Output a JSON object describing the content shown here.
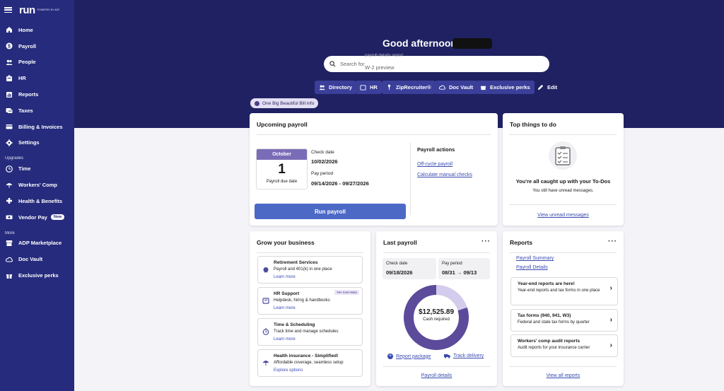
{
  "sidebar": {
    "logo": "run",
    "logo_sub": "POWERED BY ADP",
    "items": [
      {
        "label": "Home",
        "icon": "home-icon"
      },
      {
        "label": "Payroll",
        "icon": "dollar-icon"
      },
      {
        "label": "People",
        "icon": "people-icon"
      },
      {
        "label": "HR",
        "icon": "hr-icon"
      },
      {
        "label": "Reports",
        "icon": "reports-icon"
      },
      {
        "label": "Taxes",
        "icon": "taxes-icon"
      },
      {
        "label": "Billing & Invoices",
        "icon": "billing-icon"
      },
      {
        "label": "Settings",
        "icon": "gear-icon"
      }
    ],
    "upgrades_label": "Upgrades",
    "upgrades": [
      {
        "label": "Time",
        "icon": "clock-icon"
      },
      {
        "label": "Workers' Comp",
        "icon": "umbrella-icon"
      },
      {
        "label": "Health & Benefits",
        "icon": "health-icon"
      },
      {
        "label": "Vendor Pay",
        "icon": "vendor-icon",
        "badge": "New"
      }
    ],
    "more_label": "More",
    "more": [
      {
        "label": "ADP Marketplace",
        "icon": "marketplace-icon"
      },
      {
        "label": "Doc Vault",
        "icon": "cloud-icon"
      },
      {
        "label": "Exclusive perks",
        "icon": "gift-icon"
      }
    ]
  },
  "header": {
    "greeting": "Good afternoon,",
    "search_placeholder": "Search for",
    "search_ghost_1": "payroll details report",
    "search_ghost_2": "W-2 preview",
    "quick_links": [
      "Directory",
      "HR",
      "ZipRecruiter®",
      "Doc Vault",
      "Exclusive perks",
      "Edit"
    ],
    "info_pill": "One Big Beautiful Bill info"
  },
  "upcoming": {
    "title": "Upcoming payroll",
    "month": "October",
    "day": "1",
    "due_label": "Payroll due date",
    "check_date_label": "Check date",
    "check_date": "10/02/2026",
    "pay_period_label": "Pay period",
    "pay_period": "09/14/2026 - 09/27/2026",
    "actions_title": "Payroll actions",
    "off_cycle": "Off-cycle payroll",
    "calc_manual": "Calculate manual checks",
    "run_button": "Run payroll"
  },
  "todo": {
    "title": "Top things to do",
    "headline": "You're all caught up with your To-Dos",
    "sub": "You still have unread messages.",
    "link": "View unread messages"
  },
  "grow": {
    "title": "Grow your business",
    "items": [
      {
        "title": "Retirement Services",
        "desc": "Payroll and 401(k) in one place",
        "link": "Learn more"
      },
      {
        "title": "HR Support",
        "desc": "Helpdesk, hiring & handbooks",
        "link": "Learn more",
        "tag": "TRY FOR FREE"
      },
      {
        "title": "Time & Scheduling",
        "desc": "Track time and manage schedules",
        "link": "Learn more"
      },
      {
        "title": "Health insurance - Simplified!",
        "desc": "Affordable coverage, seamless setup",
        "link": "Explore options"
      }
    ]
  },
  "last_payroll": {
    "title": "Last payroll",
    "check_date_label": "Check date",
    "check_date": "09/18/2026",
    "pay_period_label": "Pay period",
    "pay_start": "08/31",
    "pay_arrow": "→",
    "pay_end": "09/13",
    "amount": "$12,525.89",
    "amount_label": "Cash required",
    "report_package": "Report package",
    "track_delivery": "Track delivery",
    "details": "Payroll details",
    "donut_fraction_main": 0.8,
    "donut_color_main": "#5c4a9a",
    "donut_color_light": "#d4ccec"
  },
  "reports": {
    "title": "Reports",
    "links": [
      "Payroll Summary",
      "Payroll Details"
    ],
    "items": [
      {
        "title": "Year-end reports are here!",
        "desc": "Year-end reports and tax forms in one place"
      },
      {
        "title": "Tax forms (940, 941, W3)",
        "desc": "Federal and state tax forms by quarter"
      },
      {
        "title": "Workers' comp audit reports",
        "desc": "Audit reports for your insurance carrier"
      }
    ],
    "view_all": "View all reports"
  }
}
